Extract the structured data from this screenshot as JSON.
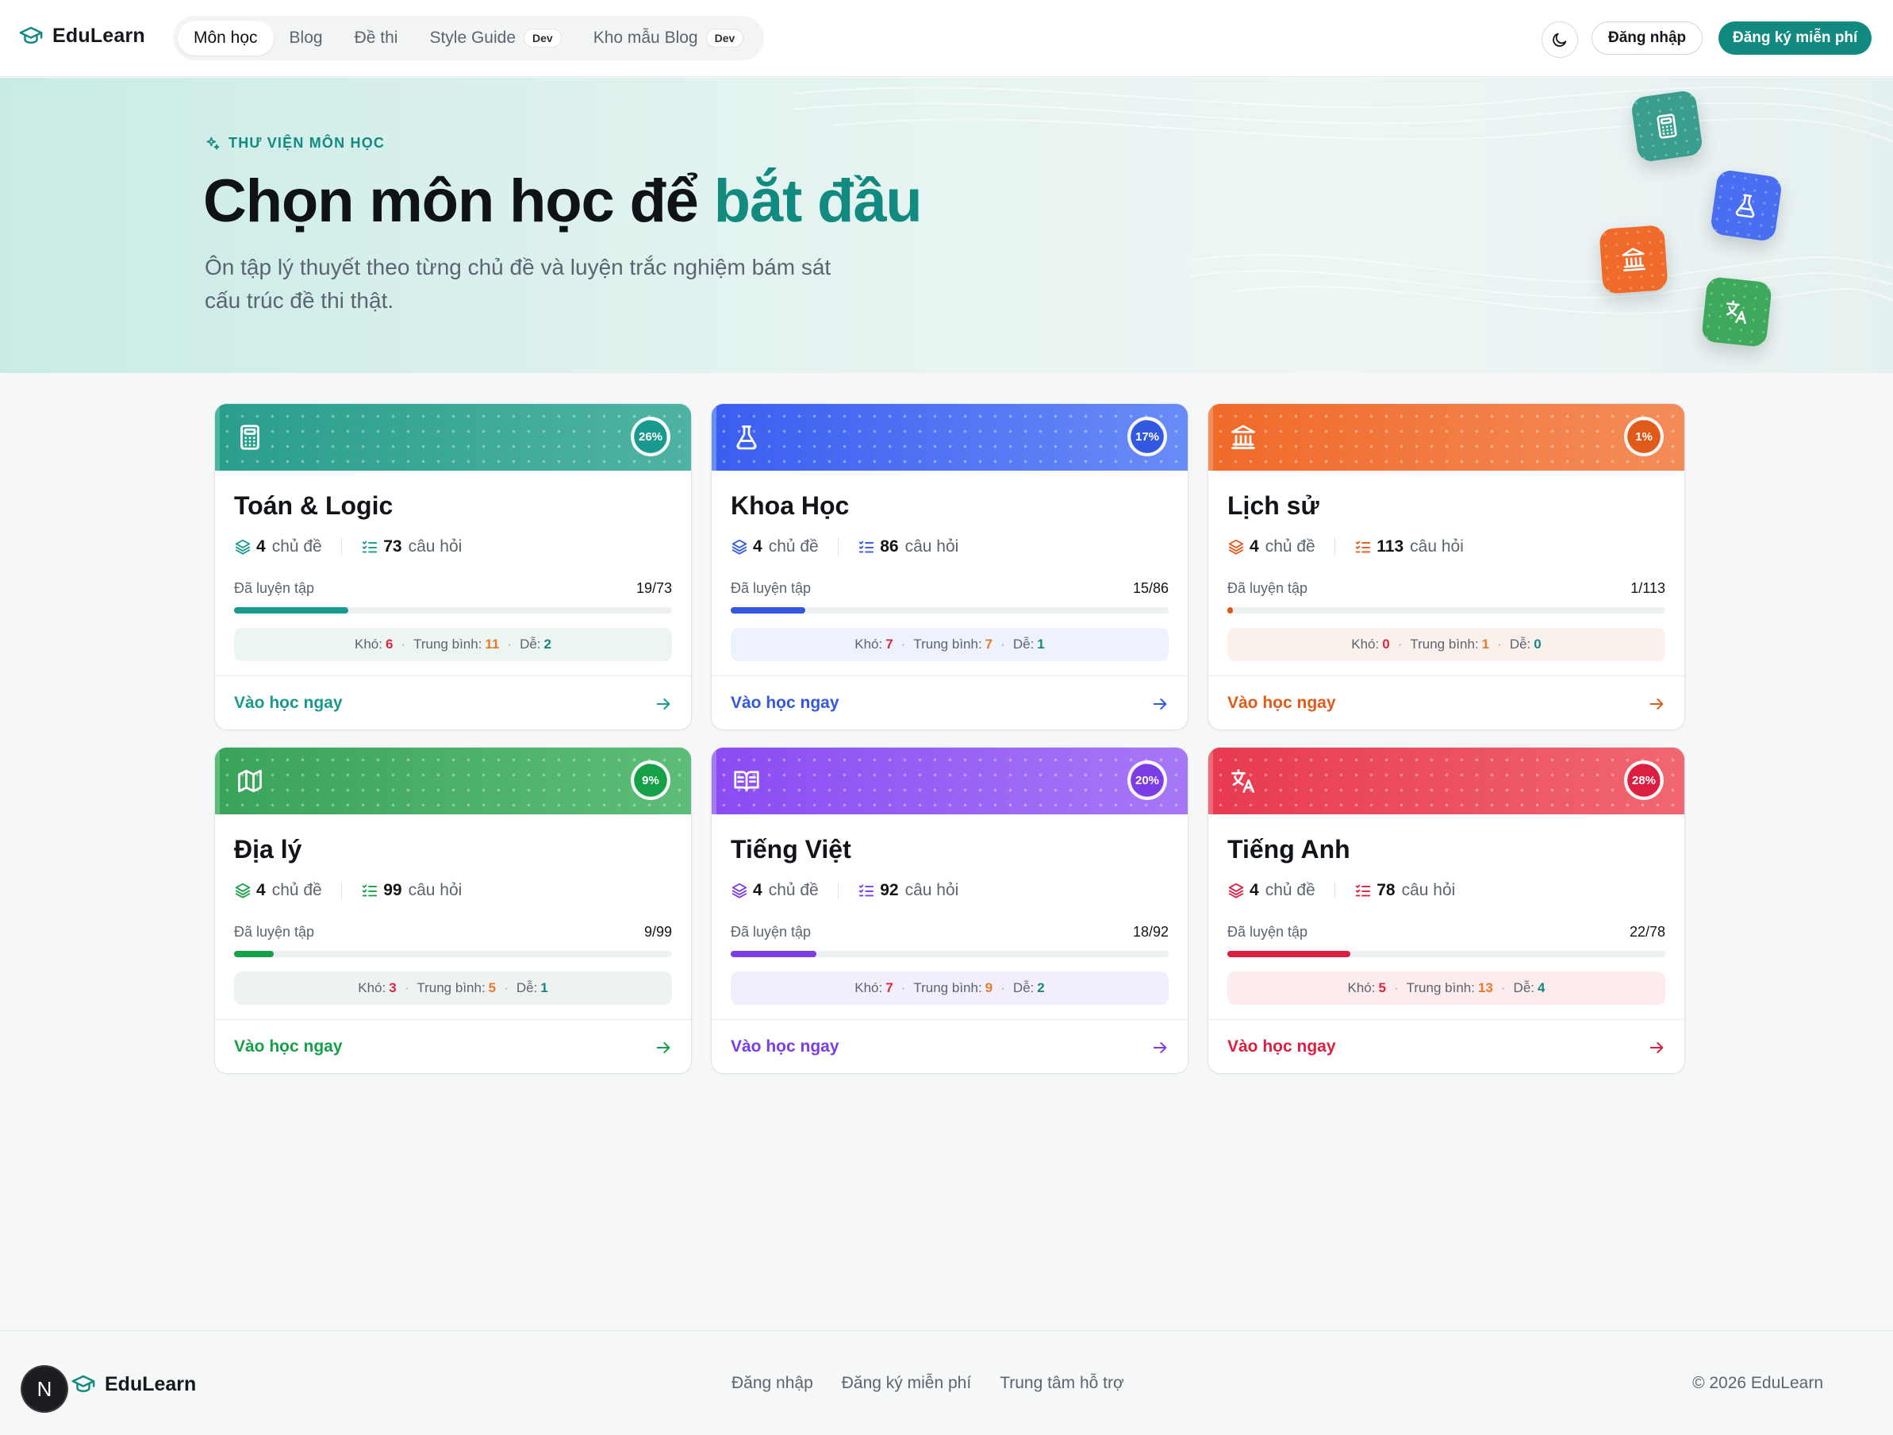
{
  "brand": {
    "name": "EduLearn"
  },
  "nav": {
    "items": [
      {
        "label": "Môn học",
        "active": true
      },
      {
        "label": "Blog"
      },
      {
        "label": "Đề thi"
      },
      {
        "label": "Style Guide",
        "badge": "Dev"
      },
      {
        "label": "Kho mẫu Blog",
        "badge": "Dev"
      }
    ],
    "login": "Đăng nhập",
    "signup": "Đăng ký miễn phí"
  },
  "hero": {
    "eyebrow": "THƯ VIỆN MÔN HỌC",
    "title_main": "Chọn môn học để ",
    "title_accent": "bắt đầu",
    "subtitle": "Ôn tập lý thuyết theo từng chủ đề và luyện trắc nghiệm bám sát cấu trúc đề thi thật.",
    "floating_icons": [
      "calculator-icon",
      "flask-icon",
      "landmark-icon",
      "translate-icon"
    ]
  },
  "labels": {
    "topics_suffix": "chủ đề",
    "questions_suffix": "câu hỏi",
    "practiced": "Đã luyện tập",
    "hard": "Khó:",
    "medium": "Trung bình:",
    "easy": "Dễ:",
    "cta": "Vào học ngay"
  },
  "subjects": [
    {
      "name": "Toán & Logic",
      "icon": "calculator-icon",
      "color": "#1a9a8c",
      "grad": [
        "#2a9e8d",
        "#4fb3a2"
      ],
      "tint": "#edf5f3",
      "percent": "26%",
      "progress": 0.26,
      "topics": "4",
      "questions": "73",
      "done": "19/73",
      "hard": "6",
      "medium": "11",
      "easy": "2"
    },
    {
      "name": "Khoa Học",
      "icon": "flask-icon",
      "color": "#3358e0",
      "grad": [
        "#3b5ef0",
        "#6a8cf6"
      ],
      "tint": "#eef2fc",
      "percent": "17%",
      "progress": 0.17,
      "topics": "4",
      "questions": "86",
      "done": "15/86",
      "hard": "7",
      "medium": "7",
      "easy": "1"
    },
    {
      "name": "Lịch sử",
      "icon": "landmark-icon",
      "color": "#e05a1a",
      "grad": [
        "#f06a2a",
        "#f48d5a"
      ],
      "tint": "#fbf1ec",
      "percent": "1%",
      "progress": 0.01,
      "topics": "4",
      "questions": "113",
      "done": "1/113",
      "hard": "0",
      "medium": "1",
      "easy": "0"
    },
    {
      "name": "Địa lý",
      "icon": "map-icon",
      "color": "#16a048",
      "grad": [
        "#3aa35a",
        "#5ebd78"
      ],
      "tint": "#eef3f1",
      "percent": "9%",
      "progress": 0.09,
      "topics": "4",
      "questions": "99",
      "done": "9/99",
      "hard": "3",
      "medium": "5",
      "easy": "1"
    },
    {
      "name": "Tiếng Việt",
      "icon": "book-icon",
      "color": "#7a3de6",
      "grad": [
        "#8b4cf2",
        "#a679f6"
      ],
      "tint": "#f2eefc",
      "percent": "20%",
      "progress": 0.196,
      "topics": "4",
      "questions": "92",
      "done": "18/92",
      "hard": "7",
      "medium": "9",
      "easy": "2"
    },
    {
      "name": "Tiếng Anh",
      "icon": "translate-icon",
      "color": "#dc1f40",
      "grad": [
        "#e83a50",
        "#f06872"
      ],
      "tint": "#fcecee",
      "percent": "28%",
      "progress": 0.28,
      "topics": "4",
      "questions": "78",
      "done": "22/78",
      "hard": "5",
      "medium": "13",
      "easy": "4"
    }
  ],
  "footer": {
    "links": [
      "Đăng nhập",
      "Đăng ký miễn phí",
      "Trung tâm hỗ trợ"
    ],
    "copyright": "© 2026 EduLearn"
  },
  "dev_badge": "N"
}
